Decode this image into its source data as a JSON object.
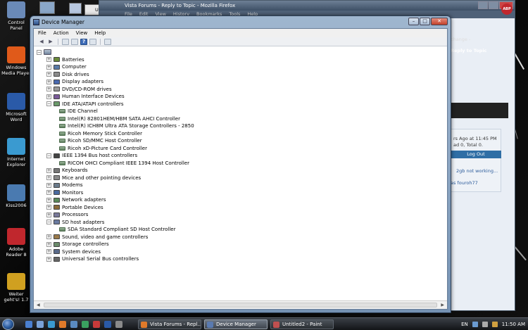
{
  "desktop": {
    "icons": [
      {
        "label": "Control\nPanel"
      },
      {
        "label": "Windows\nMedia Player"
      },
      {
        "label": "Microsoft\nWord"
      },
      {
        "label": "Internet\nExplorer"
      },
      {
        "label": "Kiss2006"
      },
      {
        "label": "Adobe\nReader 8"
      },
      {
        "label": "Weiter\ngeht's! 1.7"
      }
    ]
  },
  "firefox": {
    "title": "Vista Forums - Reply to Topic - Mozilla Firefox",
    "menu": [
      "File",
      "Edit",
      "View",
      "History",
      "Bookmarks",
      "Tools",
      "Help"
    ],
    "tab_label": "Reply to Topic",
    "change_label": "change -",
    "posted_text": "rs Ago at 11:45 PM",
    "ad_text": "ad 0, Total 0.",
    "logout_label": "Log Out",
    "thread_text": "2gb not working...",
    "by_text": "as fouroh77"
  },
  "device_manager": {
    "title": "Device Manager",
    "menu": {
      "file": "File",
      "action": "Action",
      "view": "View",
      "help": "Help"
    },
    "tree": [
      {
        "label": "Batteries",
        "expanded": false,
        "color": "#6a8a3a"
      },
      {
        "label": "Computer",
        "expanded": false,
        "color": "#5a7aa8"
      },
      {
        "label": "Disk drives",
        "expanded": false,
        "color": "#8a8a8a"
      },
      {
        "label": "Display adapters",
        "expanded": false,
        "color": "#4a6ab0"
      },
      {
        "label": "DVD/CD-ROM drives",
        "expanded": false,
        "color": "#9a9a9a"
      },
      {
        "label": "Human Interface Devices",
        "expanded": false,
        "color": "#7a5a9a"
      },
      {
        "label": "IDE ATA/ATAPI controllers",
        "expanded": true,
        "color": "#6a9a6a",
        "children": [
          "IDE Channel",
          "Intel(R) 82801HEM/HBM SATA AHCI Controller",
          "Intel(R) ICH8M Ultra ATA Storage Controllers - 2850",
          "Ricoh Memory Stick Controller",
          "Ricoh SD/MMC Host Controller",
          "Ricoh xD-Picture Card Controller"
        ]
      },
      {
        "label": "IEEE 1394 Bus host controllers",
        "expanded": true,
        "color": "#444444",
        "children": [
          "RICOH OHCI Compliant IEEE 1394 Host Controller"
        ]
      },
      {
        "label": "Keyboards",
        "expanded": false,
        "color": "#777777"
      },
      {
        "label": "Mice and other pointing devices",
        "expanded": false,
        "color": "#888888"
      },
      {
        "label": "Modems",
        "expanded": false,
        "color": "#6a7a8a"
      },
      {
        "label": "Monitors",
        "expanded": false,
        "color": "#4a6aa0"
      },
      {
        "label": "Network adapters",
        "expanded": false,
        "color": "#5a8a5a"
      },
      {
        "label": "Portable Devices",
        "expanded": false,
        "color": "#8a6a3a"
      },
      {
        "label": "Processors",
        "expanded": false,
        "color": "#7a7a9a"
      },
      {
        "label": "SD host adapters",
        "expanded": true,
        "color": "#6a7aa0",
        "children": [
          "SDA Standard Compliant SD Host Controller"
        ]
      },
      {
        "label": "Sound, video and game controllers",
        "expanded": false,
        "color": "#9a7a4a"
      },
      {
        "label": "Storage controllers",
        "expanded": false,
        "color": "#6a8a6a"
      },
      {
        "label": "System devices",
        "expanded": false,
        "color": "#5a6a8a"
      },
      {
        "label": "Universal Serial Bus controllers",
        "expanded": false,
        "color": "#666666"
      }
    ]
  },
  "taskbar": {
    "tasks": [
      {
        "label": "Vista Forums - Repl...",
        "active": false,
        "icon_color": "#e07a2a"
      },
      {
        "label": "Device Manager",
        "active": true,
        "icon_color": "#5a7ab0"
      },
      {
        "label": "Untitled2 - Paint",
        "active": false,
        "icon_color": "#c05050"
      }
    ],
    "language": "EN",
    "clock": "11:50 AM"
  },
  "thumbnails": {
    "untitled_label": "Untitle"
  }
}
